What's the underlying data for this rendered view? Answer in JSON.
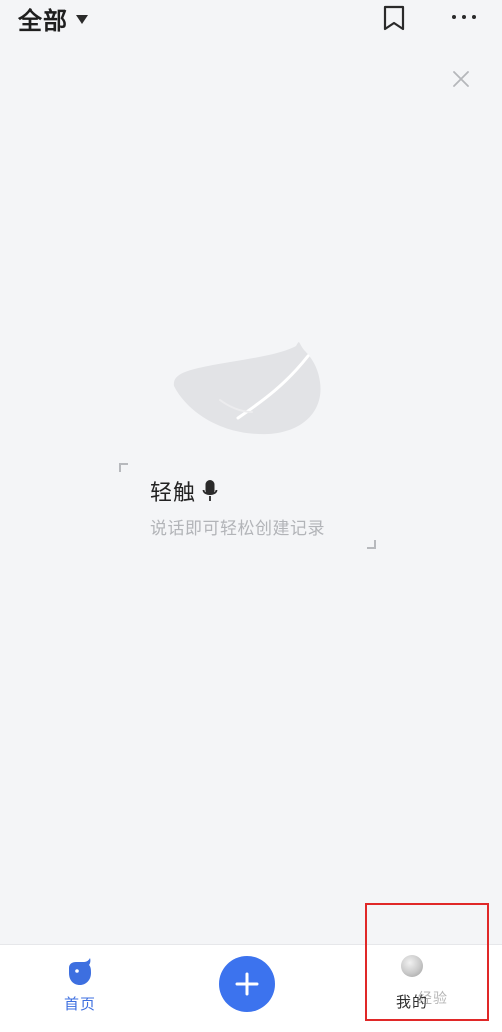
{
  "header": {
    "filter_label": "全部"
  },
  "empty_state": {
    "voice_title": "轻触",
    "voice_subtitle": "说话即可轻松创建记录"
  },
  "tabbar": {
    "home_label": "首页",
    "mine_label": "我的"
  },
  "watermark": "经验",
  "colors": {
    "accent": "#3c73ee",
    "highlight": "#e02828",
    "background": "#f4f5f7"
  },
  "icons": {
    "filter": "caret-down-icon",
    "bookmark": "bookmark-icon",
    "more": "more-dots-icon",
    "close": "close-icon",
    "voice": "microphone-icon",
    "home": "whale-icon",
    "add": "plus-icon",
    "mine": "avatar"
  }
}
